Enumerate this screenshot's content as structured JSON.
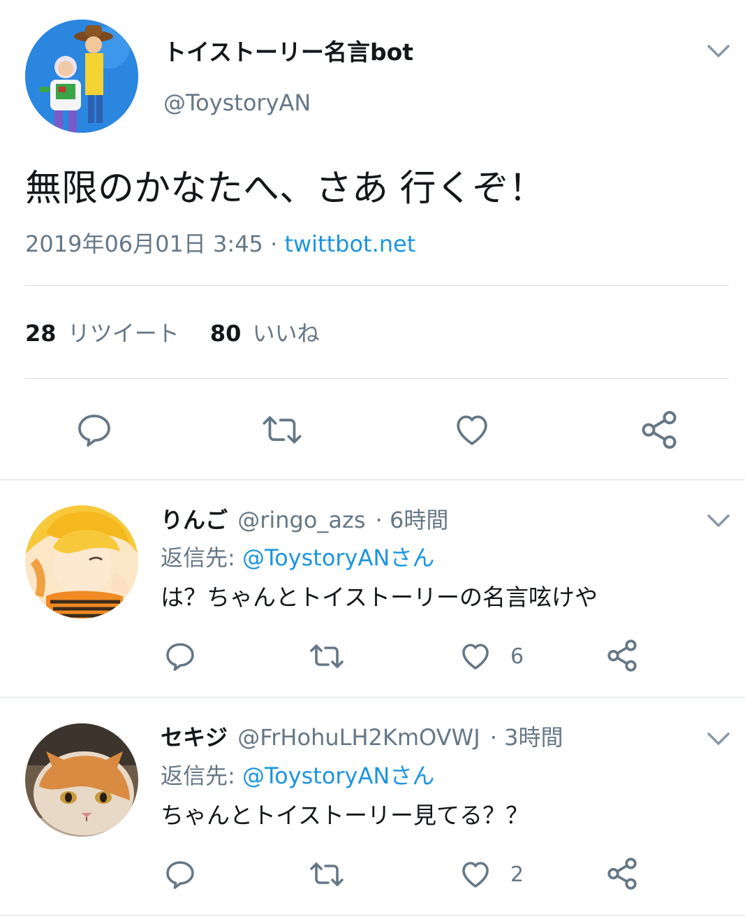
{
  "main_tweet": {
    "display_name": "トイストーリー名言bot",
    "handle": "@ToystoryAN",
    "text": "無限のかなたへ、さあ 行くぞ！",
    "timestamp": "2019年06月01日 3:45",
    "separator": "·",
    "source": "twittbot.net",
    "retweet_count": "28",
    "retweet_label": "リツイート",
    "like_count": "80",
    "like_label": "いいね"
  },
  "replies": [
    {
      "display_name": "りんご",
      "handle": "@ringo_azs",
      "time": "· 6時間",
      "reply_to_prefix": "返信先:",
      "reply_to": "@ToystoryANさん",
      "text": "は？ちゃんとトイストーリーの名言呟けや",
      "like_count": "6"
    },
    {
      "display_name": "セキジ",
      "handle": "@FrHohuLH2KmOVWJ",
      "time": "· 3時間",
      "reply_to_prefix": "返信先:",
      "reply_to": "@ToystoryANさん",
      "text": "ちゃんとトイストーリー見てる？？",
      "like_count": "2"
    }
  ],
  "icons": [
    "chevron-down-icon",
    "reply-icon",
    "retweet-icon",
    "like-icon",
    "share-icon"
  ],
  "colors": {
    "link": "#1b95e0",
    "secondary_text": "#657786",
    "divider": "#d8e0e6",
    "icon": "#657786"
  }
}
